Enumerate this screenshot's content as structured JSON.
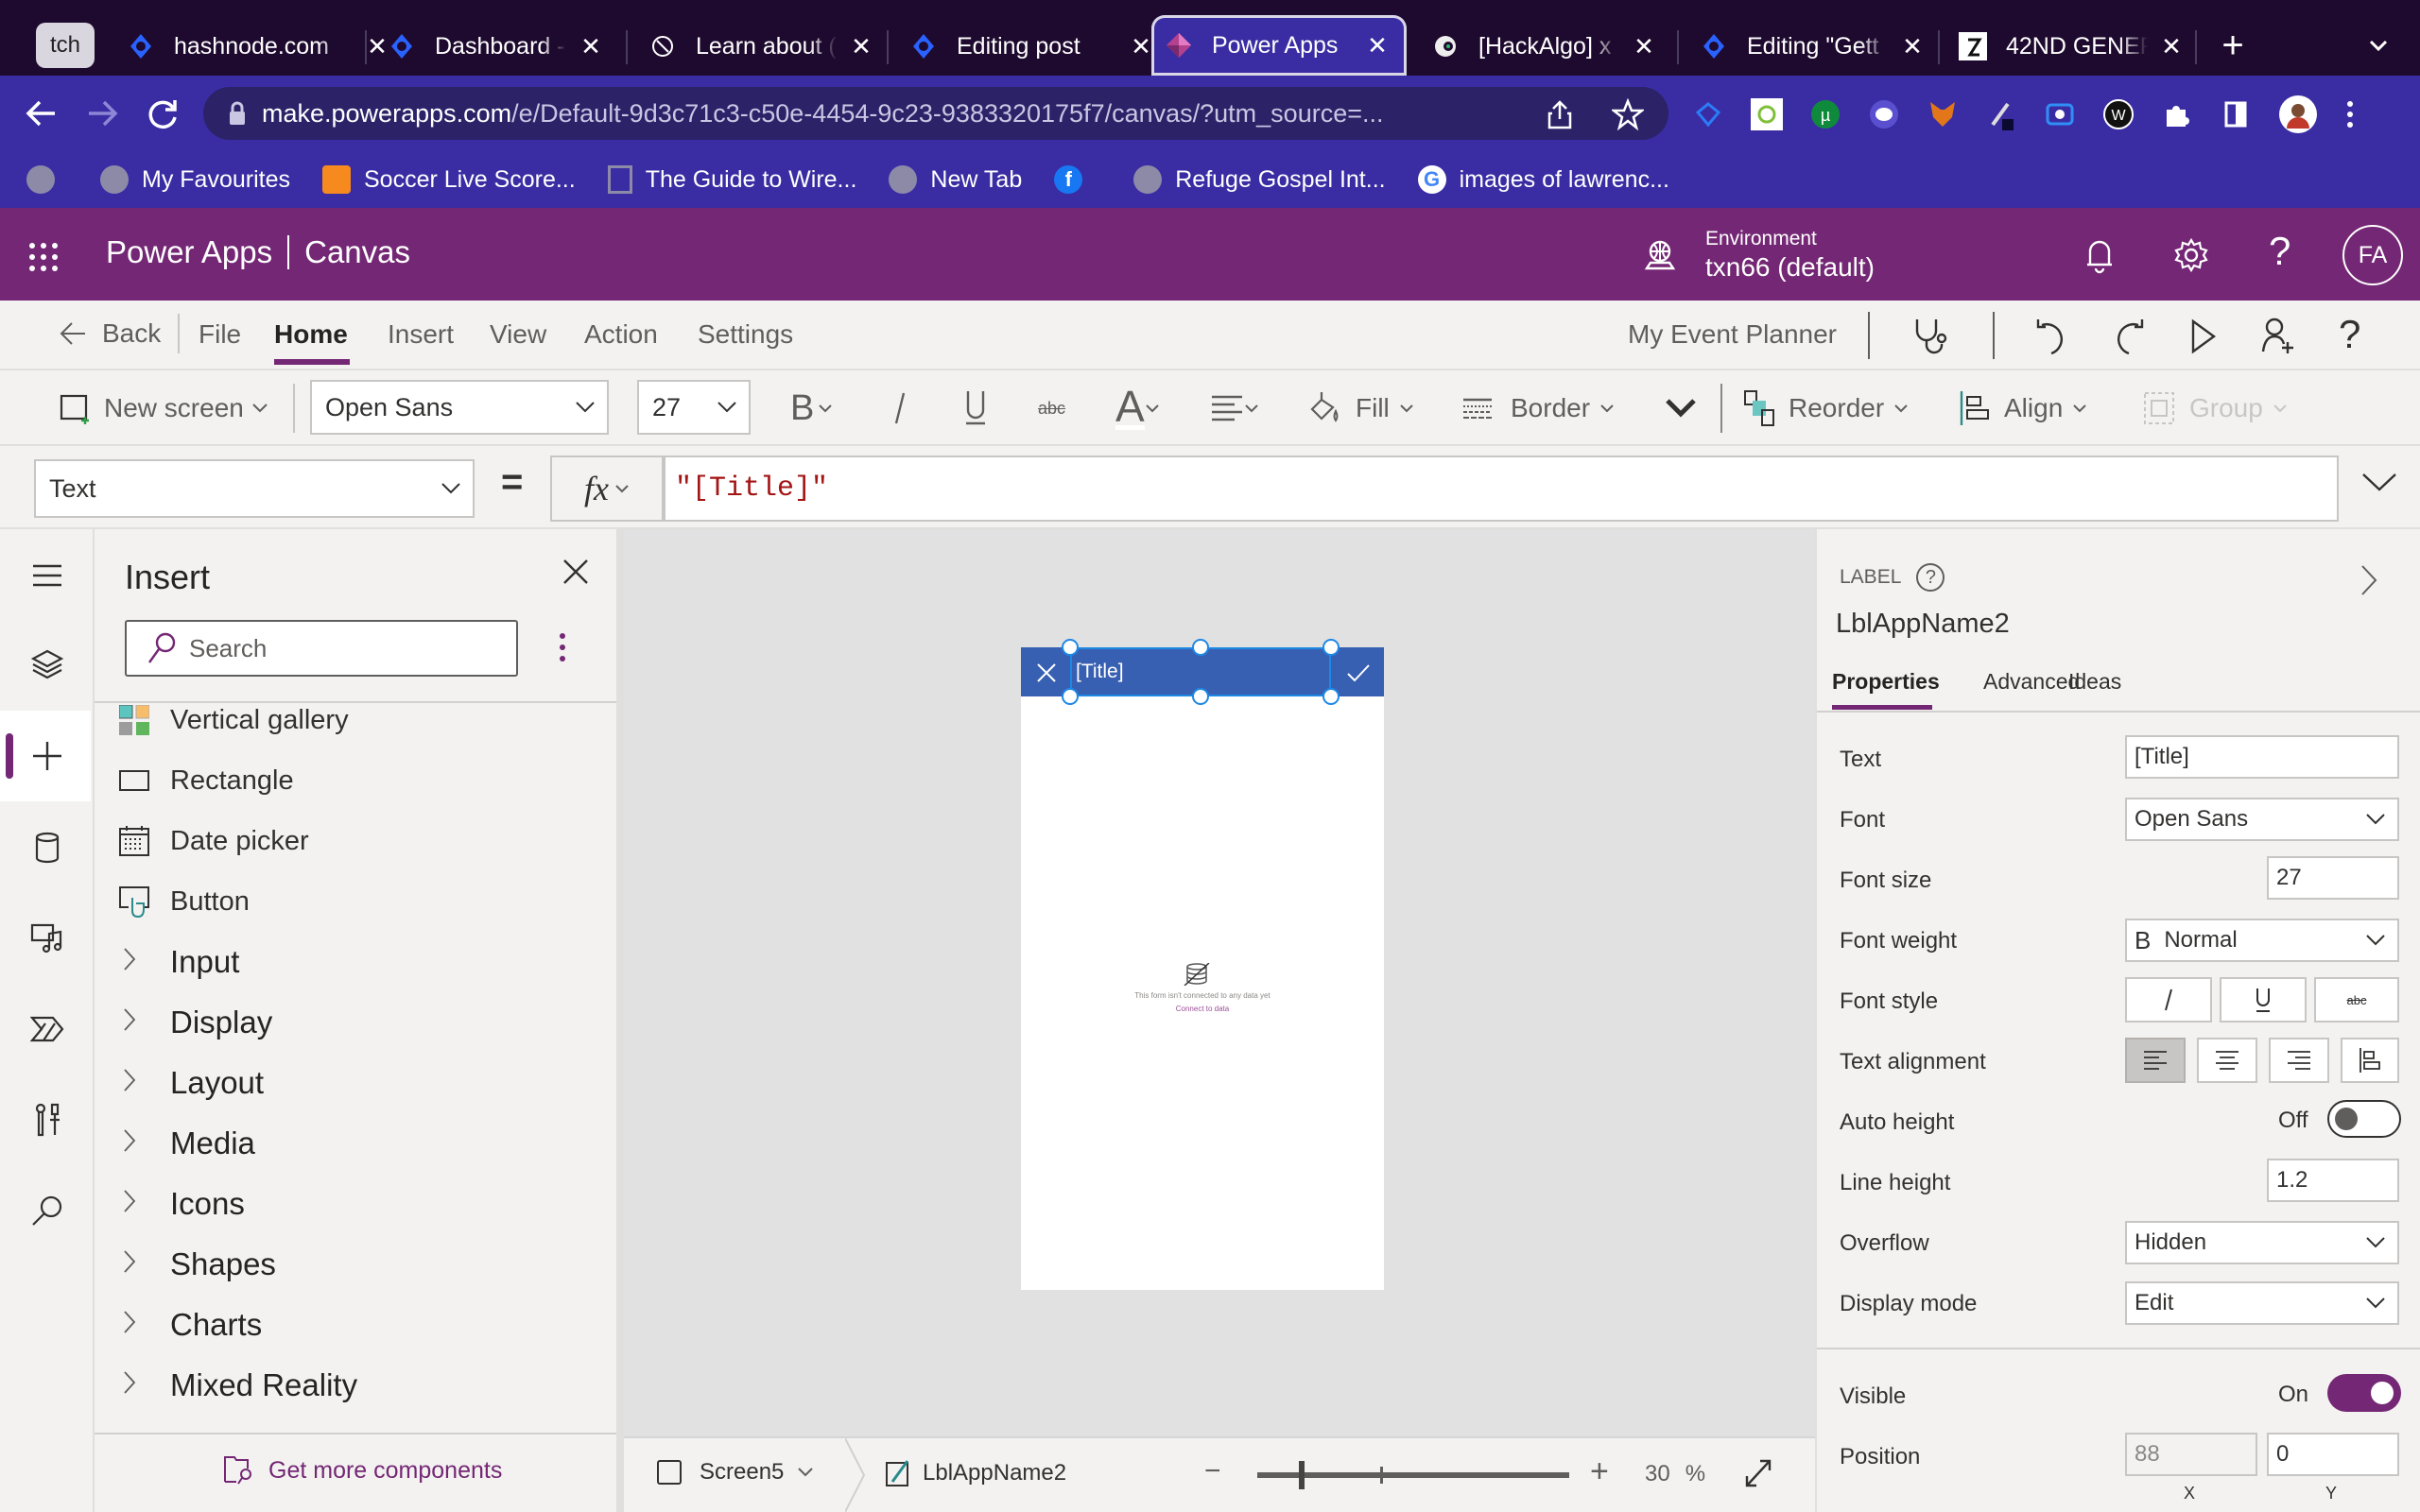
{
  "browser": {
    "tabs": [
      {
        "title": "tch",
        "pinned": true
      },
      {
        "title": "hashnode.com",
        "icon": "hashnode-icon"
      },
      {
        "title": "Dashboard - ",
        "icon": "hashnode-icon"
      },
      {
        "title": "Learn about (",
        "icon": "globe-outline-icon"
      },
      {
        "title": "Editing post",
        "icon": "hashnode-icon"
      },
      {
        "title": "Power Apps",
        "icon": "powerapps-icon",
        "active": true
      },
      {
        "title": "[HackAlgo] x",
        "icon": "hackalgo-icon"
      },
      {
        "title": "Editing \"Gett",
        "icon": "hashnode-icon"
      },
      {
        "title": "42ND GENER",
        "icon": "site-icon"
      }
    ],
    "close_glyph": "✕",
    "new_tab_glyph": "+",
    "url_host": "make.powerapps.com",
    "url_path": "/e/Default-9d3c71c3-c50e-4454-9c23-9383320175f7/canvas/?utm_source=...",
    "bookmarks": [
      {
        "label": "",
        "icon": "globe-icon"
      },
      {
        "label": "My Favourites",
        "icon": "globe-icon"
      },
      {
        "label": "Soccer Live Score...",
        "icon": "livescore-icon"
      },
      {
        "label": "The Guide to Wire...",
        "icon": "blank-page-icon"
      },
      {
        "label": "New Tab",
        "icon": "globe-icon"
      },
      {
        "label": "",
        "icon": "facebook-icon"
      },
      {
        "label": "Refuge Gospel Int...",
        "icon": "globe-icon"
      },
      {
        "label": "images of lawrenc...",
        "icon": "google-icon"
      }
    ]
  },
  "app": {
    "name": "Power Apps",
    "section": "Canvas",
    "environment_label": "Environment",
    "environment_value": "txn66 (default)",
    "avatar_initials": "FA",
    "accent": "#742774"
  },
  "menu": {
    "back": "Back",
    "items": [
      "File",
      "Home",
      "Insert",
      "View",
      "Action",
      "Settings"
    ],
    "active": "Home",
    "app_title": "My Event Planner"
  },
  "toolbar": {
    "new_screen": "New screen",
    "font": "Open Sans",
    "font_size": "27",
    "fill": "Fill",
    "border": "Border",
    "reorder": "Reorder",
    "align": "Align",
    "group": "Group"
  },
  "formula": {
    "property": "Text",
    "equals": "=",
    "fx": "fx",
    "value": "\"[Title]\""
  },
  "insert_panel": {
    "title": "Insert",
    "search_placeholder": "Search",
    "items": [
      {
        "label": "Vertical gallery",
        "icon": "gallery-icon"
      },
      {
        "label": "Rectangle",
        "icon": "rectangle-icon"
      },
      {
        "label": "Date picker",
        "icon": "calendar-icon"
      },
      {
        "label": "Button",
        "icon": "button-icon"
      }
    ],
    "groups": [
      "Input",
      "Display",
      "Layout",
      "Media",
      "Icons",
      "Shapes",
      "Charts",
      "Mixed Reality"
    ],
    "footer_link": "Get more components"
  },
  "canvas": {
    "header_label": "[Title]",
    "header_color": "#3860b2",
    "empty_message": "This form isn't connected to any data yet",
    "connect_link": "Connect to data"
  },
  "statusbar": {
    "screen": "Screen5",
    "control": "LblAppName2",
    "zoom_value": "30",
    "zoom_unit": "%",
    "zoom_minus": "−",
    "zoom_plus": "+"
  },
  "properties": {
    "control_type": "LABEL",
    "control_name": "LblAppName2",
    "tabs": [
      "Properties",
      "Advanced",
      "Ideas"
    ],
    "active_tab": "Properties",
    "text_label": "Text",
    "text_value": "[Title]",
    "font_label": "Font",
    "font_value": "Open Sans",
    "font_size_label": "Font size",
    "font_size_value": "27",
    "font_weight_label": "Font weight",
    "font_weight_value": "Normal",
    "font_weight_glyph": "B",
    "font_style_label": "Font style",
    "text_alignment_label": "Text alignment",
    "auto_height_label": "Auto height",
    "auto_height_state": "Off",
    "line_height_label": "Line height",
    "line_height_value": "1.2",
    "overflow_label": "Overflow",
    "overflow_value": "Hidden",
    "display_mode_label": "Display mode",
    "display_mode_value": "Edit",
    "visible_label": "Visible",
    "visible_state": "On",
    "position_label": "Position",
    "position_x": "88",
    "position_y": "0",
    "x_label": "X",
    "y_label": "Y"
  }
}
